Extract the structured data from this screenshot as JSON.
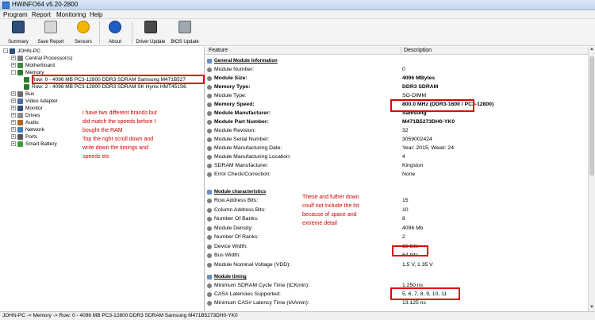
{
  "window": {
    "title": "HWiNFO64 v5.20-2800"
  },
  "menu": [
    "Program",
    "Report",
    "Monitoring",
    "Help"
  ],
  "toolbar": {
    "summary": "Summary",
    "save_report": "Save Report",
    "sensors": "Sensors",
    "about": "About",
    "driver_update": "Driver Update",
    "bios_update": "BIOS Update"
  },
  "tree": {
    "root": "JOHN-PC",
    "cpu": "Central Processor(s)",
    "motherboard": "Motherboard",
    "memory": "Memory",
    "row0": "Row: 0 - 4096 MB PC3-12800 DDR3 SDRAM Samsung M471B527",
    "row2": "Row: 2 - 4096 MB PC3-12800 DDR3 SDRAM SK Hynix HMT451S6",
    "bus": "Bus",
    "video": "Video Adapter",
    "monitor": "Monitor",
    "drives": "Drives",
    "audio": "Audio",
    "network": "Network",
    "ports": "Ports",
    "battery": "Smart Battery"
  },
  "annotations": {
    "left_note": [
      "i have two different brands but",
      "did match the speeds before I",
      "bought the RAM",
      "Top the right scroll down and",
      "write down the timings and",
      "speeds etc"
    ],
    "right_note": [
      "These and futher down",
      "coulf not include the lot",
      "because of space and",
      "extreme detail"
    ]
  },
  "details": {
    "col_feature": "Feature",
    "col_description": "Description",
    "section_general": "General Module Information",
    "section_characteristics": "Module characteristics",
    "section_timing": "Module timing",
    "general": [
      {
        "f": "Module Number:",
        "v": "0",
        "bold": false
      },
      {
        "f": "Module Size:",
        "v": "4096 MBytes",
        "bold": true
      },
      {
        "f": "Memory Type:",
        "v": "DDR3 SDRAM",
        "bold": true
      },
      {
        "f": "Module Type:",
        "v": "SO-DIMM",
        "bold": false
      },
      {
        "f": "Memory Speed:",
        "v": "800.0 MHz (DDR3-1600 / PC3-12800)",
        "bold": true
      },
      {
        "f": "Module Manufacturer:",
        "v": "Samsung",
        "bold": true
      },
      {
        "f": "Module Part Number:",
        "v": "M471B5273DH0-YK0",
        "bold": true
      },
      {
        "f": "Module Revision:",
        "v": "32",
        "bold": false
      },
      {
        "f": "Module Serial Number:",
        "v": "3059002424",
        "bold": false
      },
      {
        "f": "Module Manufacturing Date:",
        "v": "Year: 2015, Week: 24",
        "bold": false
      },
      {
        "f": "Module Manufacturing Location:",
        "v": "4",
        "bold": false
      },
      {
        "f": "SDRAM Manufacturer:",
        "v": "Kingston",
        "bold": false
      },
      {
        "f": "Error Check/Correction:",
        "v": "None",
        "bold": false
      }
    ],
    "characteristics": [
      {
        "f": "Row Address Bits:",
        "v": "15",
        "bold": false
      },
      {
        "f": "Column Address Bits:",
        "v": "10",
        "bold": false
      },
      {
        "f": "Number Of Banks:",
        "v": "8",
        "bold": false
      },
      {
        "f": "Module Density:",
        "v": "4096 Mb",
        "bold": false
      },
      {
        "f": "Number Of Ranks:",
        "v": "2",
        "bold": false
      },
      {
        "f": "Device Width:",
        "v": "16 bits",
        "bold": false
      },
      {
        "f": "Bus Width:",
        "v": "64 bits",
        "bold": false
      },
      {
        "f": "Module Nominal Voltage (VDD):",
        "v": "1.5 V, 1.35 V",
        "bold": false
      }
    ],
    "timing": [
      {
        "f": "Minimum SDRAM Cycle Time (tCKmin):",
        "v": "1.250 ns",
        "bold": false
      },
      {
        "f": "CAS# Latencies Supported:",
        "v": "5, 6, 7, 8, 9, 10, 11",
        "bold": false
      },
      {
        "f": "Minimum CAS# Latency Time (tAAmin):",
        "v": "13.125 ns",
        "bold": false
      }
    ]
  },
  "status": {
    "path": "JOHN-PC -> Memory -> Row: 0 - 4096 MB PC3-12800 DDR3 SDRAM Samsung M471B5273DH0-YK0"
  }
}
